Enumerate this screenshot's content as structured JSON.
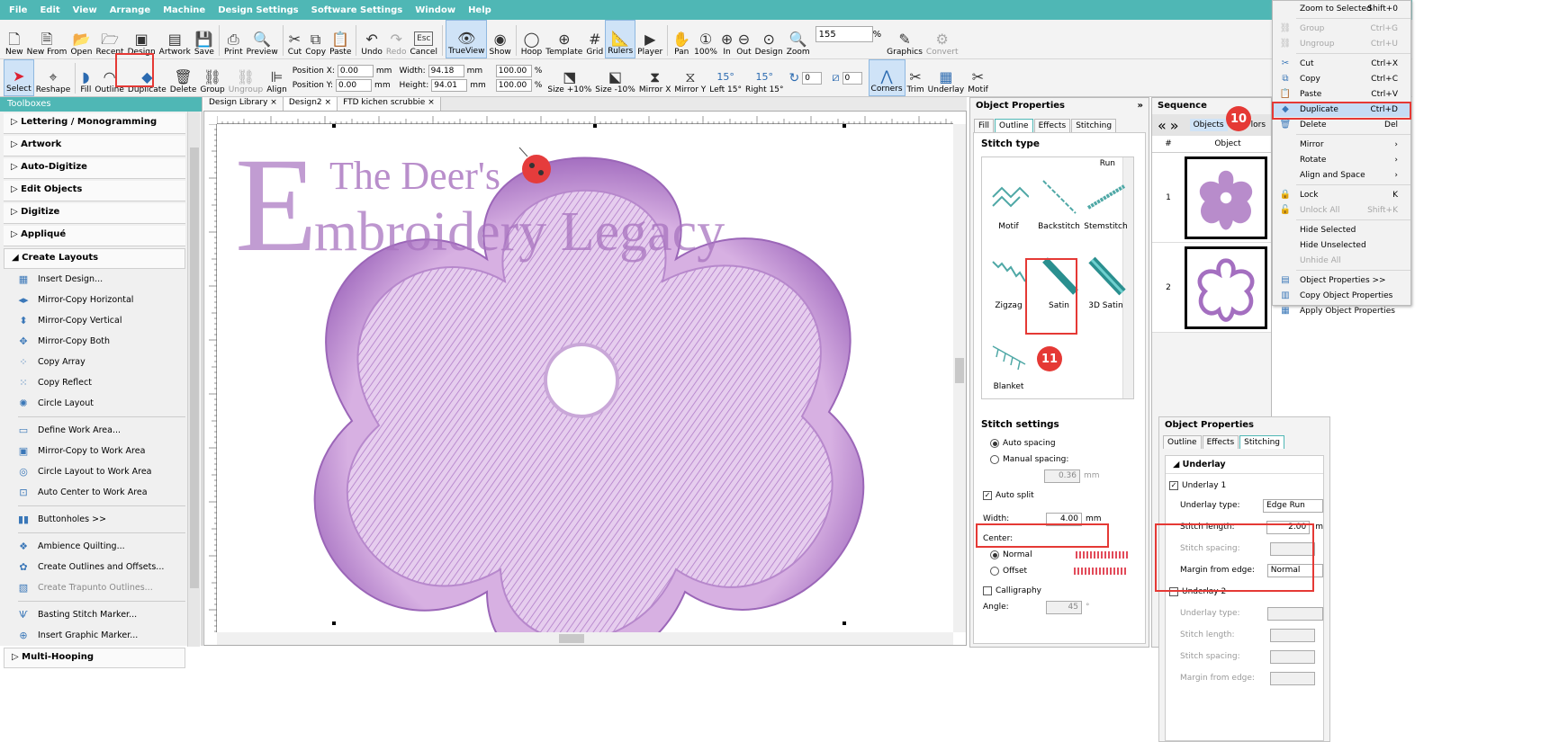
{
  "menu": [
    "File",
    "Edit",
    "View",
    "Arrange",
    "Machine",
    "Design Settings",
    "Software Settings",
    "Window",
    "Help"
  ],
  "toolbar1": [
    {
      "label": "New",
      "icon": "new-file-icon",
      "glyph": "🗋"
    },
    {
      "label": "New From",
      "icon": "new-from-icon",
      "glyph": "🗎"
    },
    {
      "label": "Open",
      "icon": "open-icon",
      "glyph": "📂"
    },
    {
      "label": "Recent",
      "icon": "recent-icon",
      "glyph": "🗁"
    },
    {
      "label": "Design",
      "icon": "design-icon",
      "glyph": "▣"
    },
    {
      "label": "Artwork",
      "icon": "artwork-icon",
      "glyph": "▤"
    },
    {
      "label": "Save",
      "icon": "save-icon",
      "glyph": "💾"
    },
    {
      "label": "Print",
      "icon": "print-icon",
      "glyph": "⎙"
    },
    {
      "label": "Preview",
      "icon": "preview-icon",
      "glyph": "🔍"
    },
    {
      "label": "Cut",
      "icon": "cut-icon",
      "glyph": "✂"
    },
    {
      "label": "Copy",
      "icon": "copy-icon",
      "glyph": "⧉"
    },
    {
      "label": "Paste",
      "icon": "paste-icon",
      "glyph": "📋"
    },
    {
      "label": "Undo",
      "icon": "undo-icon",
      "glyph": "↶"
    },
    {
      "label": "Redo",
      "icon": "redo-icon",
      "glyph": "↷"
    },
    {
      "label": "Cancel",
      "icon": "cancel-icon",
      "glyph": "Esc"
    },
    {
      "label": "TrueView",
      "icon": "trueview-icon",
      "glyph": "👁"
    },
    {
      "label": "Show",
      "icon": "show-icon",
      "glyph": "◉"
    },
    {
      "label": "Hoop",
      "icon": "hoop-icon",
      "glyph": "◯"
    },
    {
      "label": "Template",
      "icon": "template-icon",
      "glyph": "⊕"
    },
    {
      "label": "Grid",
      "icon": "grid-icon",
      "glyph": "#"
    },
    {
      "label": "Rulers",
      "icon": "rulers-icon",
      "glyph": "📐"
    },
    {
      "label": "Player",
      "icon": "player-icon",
      "glyph": "▶"
    },
    {
      "label": "Pan",
      "icon": "pan-icon",
      "glyph": "✋"
    },
    {
      "label": "100%",
      "icon": "zoom-100-icon",
      "glyph": "①"
    },
    {
      "label": "In",
      "icon": "zoom-in-icon",
      "glyph": "⊕"
    },
    {
      "label": "Out",
      "icon": "zoom-out-icon",
      "glyph": "⊖"
    },
    {
      "label": "Design",
      "icon": "zoom-design-icon",
      "glyph": "⊙"
    },
    {
      "label": "Zoom",
      "icon": "zoom-icon",
      "glyph": "🔍"
    }
  ],
  "zoom_value": "155",
  "zoom_unit": "%",
  "graphics_label": "Graphics",
  "convert_label": "Convert",
  "toolbar2": {
    "select": "Select",
    "reshape": "Reshape",
    "fill": "Fill",
    "outline": "Outline",
    "duplicate": "Duplicate",
    "delete": "Delete",
    "group": "Group",
    "ungroup": "Ungroup",
    "align": "Align",
    "position_x_label": "Position X:",
    "position_x": "0.00",
    "position_y_label": "Position Y:",
    "position_y": "0.00",
    "mm": "mm",
    "width_label": "Width:",
    "width": "94.18",
    "height_label": "Height:",
    "height": "94.01",
    "pct1": "100.00",
    "pct2": "100.00",
    "pct": "%",
    "size_up": "Size +10%",
    "size_down": "Size -10%",
    "mirror_x": "Mirror X",
    "mirror_y": "Mirror Y",
    "left15": "Left 15°",
    "right15": "Right 15°",
    "rot_value": "0",
    "slant_value": "0",
    "corners": "Corners",
    "trim": "Trim",
    "underlay": "Underlay",
    "motif": "Motif",
    "deg15": "15°"
  },
  "toolboxes": {
    "title": "Toolboxes",
    "sections": [
      "Lettering / Monogramming",
      "Artwork",
      "Auto-Digitize",
      "Edit Objects",
      "Digitize",
      "Appliqué"
    ],
    "create_layouts": "Create Layouts",
    "items": [
      {
        "label": "Insert Design...",
        "icon": "insert-design-icon",
        "glyph": "▦"
      },
      {
        "label": "Mirror-Copy Horizontal",
        "icon": "mirror-copy-horizontal-icon",
        "glyph": "◂▸"
      },
      {
        "label": "Mirror-Copy Vertical",
        "icon": "mirror-copy-vertical-icon",
        "glyph": "⬍"
      },
      {
        "label": "Mirror-Copy Both",
        "icon": "mirror-copy-both-icon",
        "glyph": "✥"
      },
      {
        "label": "Copy Array",
        "icon": "copy-array-icon",
        "glyph": "⁘"
      },
      {
        "label": "Copy Reflect",
        "icon": "copy-reflect-icon",
        "glyph": "⁙"
      },
      {
        "label": "Circle Layout",
        "icon": "circle-layout-icon",
        "glyph": "✺"
      },
      {
        "label": "Define Work Area...",
        "icon": "define-work-area-icon",
        "glyph": "▭"
      },
      {
        "label": "Mirror-Copy to Work Area",
        "icon": "mirror-copy-work-area-icon",
        "glyph": "▣"
      },
      {
        "label": "Circle Layout to Work Area",
        "icon": "circle-layout-work-area-icon",
        "glyph": "◎"
      },
      {
        "label": "Auto Center to Work Area",
        "icon": "auto-center-icon",
        "glyph": "⊡"
      },
      {
        "label": "Buttonholes >>",
        "icon": "buttonholes-icon",
        "glyph": "▮▮"
      },
      {
        "label": "Ambience Quilting...",
        "icon": "ambience-quilting-icon",
        "glyph": "❖"
      },
      {
        "label": "Create Outlines and Offsets...",
        "icon": "outlines-offsets-icon",
        "glyph": "✿"
      },
      {
        "label": "Create Trapunto Outlines...",
        "icon": "trapunto-icon",
        "glyph": "▧"
      },
      {
        "label": "Basting Stitch Marker...",
        "icon": "basting-marker-icon",
        "glyph": "Ѱ"
      },
      {
        "label": "Insert Graphic Marker...",
        "icon": "graphic-marker-icon",
        "glyph": "⊕"
      }
    ],
    "multi_hooping": "Multi-Hooping"
  },
  "tabs": [
    "Design Library",
    "Design2",
    "FTD kichen scrubbie"
  ],
  "watermark": {
    "line1": "The Deer's",
    "big_e": "E",
    "line2": "mbroidery Legacy"
  },
  "object_properties": {
    "title": "Object Properties",
    "tabs": [
      "Fill",
      "Outline",
      "Effects",
      "Stitching"
    ],
    "stitch_type": "Stitch type",
    "run": "Run",
    "stitches": [
      "Motif",
      "Backstitch",
      "Stemstitch",
      "Zigzag",
      "Satin",
      "3D Satin",
      "Blanket"
    ],
    "stitch_settings": "Stitch settings",
    "auto_spacing": "Auto spacing",
    "manual_spacing": "Manual spacing:",
    "spacing_value": "0.36",
    "mm": "mm",
    "auto_split": "Auto split",
    "width_label": "Width:",
    "width_value": "4.00",
    "center_label": "Center:",
    "normal": "Normal",
    "offset": "Offset",
    "calligraphy": "Calligraphy",
    "angle_label": "Angle:",
    "angle_value": "45",
    "deg": "°"
  },
  "sequence": {
    "title": "Sequence",
    "objects_btn": "Objects",
    "colors_btn": "lors",
    "hash": "#",
    "object_col": "Object",
    "rows": [
      "1",
      "2"
    ]
  },
  "context_menu": [
    {
      "label": "Zoom to Selected",
      "sc": "Shift+0",
      "icon": "",
      "dis": false
    },
    {
      "sep": true
    },
    {
      "label": "Group",
      "sc": "Ctrl+G",
      "icon": "group-icon",
      "glyph": "⛓",
      "dis": true
    },
    {
      "label": "Ungroup",
      "sc": "Ctrl+U",
      "icon": "ungroup-icon",
      "glyph": "⛓",
      "dis": true
    },
    {
      "sep": true
    },
    {
      "label": "Cut",
      "sc": "Ctrl+X",
      "icon": "cut-icon",
      "glyph": "✂",
      "dis": false
    },
    {
      "label": "Copy",
      "sc": "Ctrl+C",
      "icon": "copy-icon",
      "glyph": "⧉",
      "dis": false
    },
    {
      "label": "Paste",
      "sc": "Ctrl+V",
      "icon": "paste-icon",
      "glyph": "📋",
      "dis": false
    },
    {
      "label": "Duplicate",
      "sc": "Ctrl+D",
      "icon": "duplicate-icon",
      "glyph": "◆",
      "dis": false,
      "sel": true
    },
    {
      "label": "Delete",
      "sc": "Del",
      "icon": "delete-icon",
      "glyph": "🗑",
      "dis": false
    },
    {
      "sep": true
    },
    {
      "label": "Mirror",
      "sc": "›",
      "icon": "",
      "dis": false
    },
    {
      "label": "Rotate",
      "sc": "›",
      "icon": "",
      "dis": false
    },
    {
      "label": "Align and Space",
      "sc": "›",
      "icon": "",
      "dis": false
    },
    {
      "sep": true
    },
    {
      "label": "Lock",
      "sc": "K",
      "icon": "lock-icon",
      "glyph": "🔒",
      "dis": false
    },
    {
      "label": "Unlock All",
      "sc": "Shift+K",
      "icon": "unlock-icon",
      "glyph": "🔓",
      "dis": true
    },
    {
      "sep": true
    },
    {
      "label": "Hide Selected",
      "sc": "",
      "icon": "",
      "dis": false
    },
    {
      "label": "Hide Unselected",
      "sc": "",
      "icon": "",
      "dis": false
    },
    {
      "label": "Unhide All",
      "sc": "",
      "icon": "",
      "dis": true
    },
    {
      "sep": true
    },
    {
      "label": "Object Properties >>",
      "sc": "",
      "icon": "object-properties-icon",
      "glyph": "▤",
      "dis": false
    },
    {
      "label": "Copy Object Properties",
      "sc": "",
      "icon": "copy-properties-icon",
      "glyph": "▥",
      "dis": false
    },
    {
      "label": "Apply Object Properties",
      "sc": "",
      "icon": "apply-properties-icon",
      "glyph": "▦",
      "dis": false
    }
  ],
  "op2": {
    "title": "Object Properties",
    "tabs": [
      "Outline",
      "Effects",
      "Stitching"
    ],
    "underlay": "Underlay",
    "underlay1": "Underlay 1",
    "underlay_type_label": "Underlay type:",
    "underlay_type": "Edge Run",
    "stitch_length_label": "Stitch length:",
    "stitch_length": "2.00",
    "m": "m",
    "stitch_spacing_label": "Stitch spacing:",
    "margin_label": "Margin from edge:",
    "margin_value": "Normal",
    "underlay2": "Underlay 2",
    "u2_type": "Underlay type:",
    "u2_length": "Stitch length:",
    "u2_spacing": "Stitch spacing:",
    "u2_margin": "Margin from edge:"
  },
  "badges": {
    "ten": "10",
    "eleven": "11"
  },
  "colors": {
    "teal": "#4fb7b5",
    "purple": "#c598d6",
    "highlight": "#e53935"
  }
}
